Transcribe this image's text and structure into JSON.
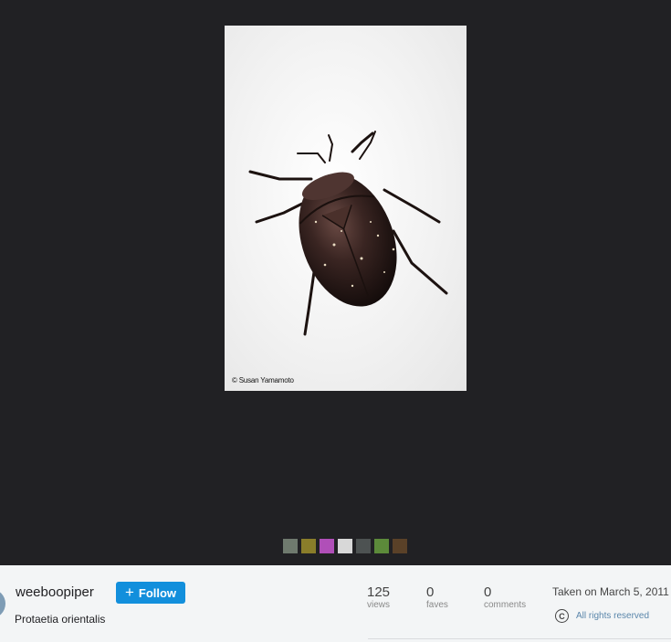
{
  "photo": {
    "watermark": "© Susan Yamamoto"
  },
  "filmstrip": {
    "thumbs": [
      {
        "name": "thumb-1",
        "color": "#6f7a6e"
      },
      {
        "name": "thumb-2",
        "color": "#8a7d2a"
      },
      {
        "name": "thumb-3",
        "color": "#b04fb8"
      },
      {
        "name": "thumb-4",
        "color": "#d8d8d8"
      },
      {
        "name": "thumb-5",
        "color": "#4d5252"
      },
      {
        "name": "thumb-6",
        "color": "#5c8a3a"
      },
      {
        "name": "thumb-7",
        "color": "#5a4128"
      }
    ]
  },
  "owner": {
    "username": "weeboopiper",
    "follow_label": "Follow"
  },
  "photo_title": "Protaetia orientalis",
  "stats": {
    "views": {
      "value": "125",
      "label": "views"
    },
    "faves": {
      "value": "0",
      "label": "faves"
    },
    "comments": {
      "value": "0",
      "label": "comments"
    }
  },
  "meta": {
    "taken": "Taken on March 5, 2011",
    "license": "All rights reserved",
    "license_icon": "copyright-icon"
  },
  "colors": {
    "viewer_bg": "#212124",
    "info_bg": "#f3f5f6",
    "accent": "#128fdc"
  }
}
